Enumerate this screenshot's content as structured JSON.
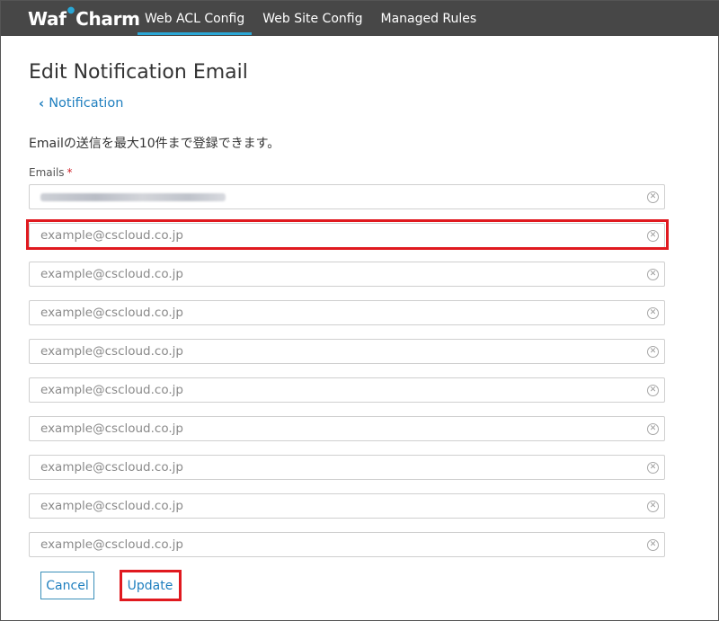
{
  "header": {
    "logo": {
      "left": "Waf",
      "right": "Charm",
      "dot_color": "#2aa7d6"
    },
    "tabs": [
      {
        "label": "Web ACL Config",
        "active": true
      },
      {
        "label": "Web Site Config",
        "active": false
      },
      {
        "label": "Managed Rules",
        "active": false
      }
    ]
  },
  "page": {
    "title": "Edit Notification Email",
    "back_link": "Notification",
    "description": "Emailの送信を最大10件まで登録できます。"
  },
  "form": {
    "emails_label": "Emails",
    "required_mark": "*",
    "placeholder": "example@cscloud.co.jp",
    "entries": [
      {
        "value": "",
        "redacted": true
      },
      {
        "value": "",
        "highlighted": true
      },
      {
        "value": ""
      },
      {
        "value": ""
      },
      {
        "value": ""
      },
      {
        "value": ""
      },
      {
        "value": ""
      },
      {
        "value": ""
      },
      {
        "value": ""
      },
      {
        "value": ""
      }
    ],
    "clear_icon": "clear-circle-icon"
  },
  "buttons": {
    "cancel": "Cancel",
    "update": "Update"
  },
  "colors": {
    "topbar": "#474747",
    "accent": "#2aa7d6",
    "link": "#1f7fbf",
    "highlight": "#e0191f",
    "required": "#d0222a"
  }
}
